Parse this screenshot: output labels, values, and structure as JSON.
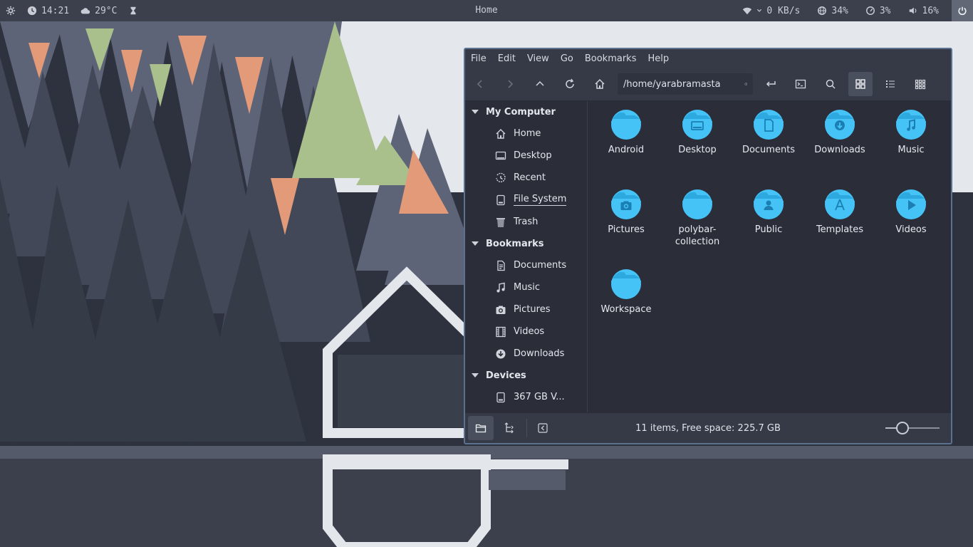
{
  "topbar": {
    "time": "14:21",
    "weather": "29°C",
    "workspace_title": "Home",
    "network_speed": "0 KB/s",
    "cpu": "34%",
    "memory": "3%",
    "volume": "16%",
    "icons": [
      "gear-icon",
      "clock-icon",
      "cloud-icon",
      "hourglass-icon",
      "wifi-icon",
      "globe-icon",
      "gauge-icon",
      "speaker-icon",
      "power-icon"
    ]
  },
  "window": {
    "menu": [
      "File",
      "Edit",
      "View",
      "Go",
      "Bookmarks",
      "Help"
    ],
    "path": "/home/yarabramasta",
    "sidebar": {
      "sections": [
        {
          "title": "My Computer",
          "items": [
            {
              "label": "Home",
              "icon": "home-icon"
            },
            {
              "label": "Desktop",
              "icon": "desktop-icon"
            },
            {
              "label": "Recent",
              "icon": "recent-icon"
            },
            {
              "label": "File System",
              "icon": "drive-icon"
            },
            {
              "label": "Trash",
              "icon": "trash-icon"
            }
          ]
        },
        {
          "title": "Bookmarks",
          "items": [
            {
              "label": "Documents",
              "icon": "documents-icon"
            },
            {
              "label": "Music",
              "icon": "music-icon"
            },
            {
              "label": "Pictures",
              "icon": "camera-icon"
            },
            {
              "label": "Videos",
              "icon": "film-icon"
            },
            {
              "label": "Downloads",
              "icon": "download-icon"
            }
          ]
        },
        {
          "title": "Devices",
          "items": [
            {
              "label": "367 GB V...",
              "icon": "drive-icon"
            }
          ]
        }
      ]
    },
    "files": [
      {
        "name": "Android",
        "glyph": ""
      },
      {
        "name": "Desktop",
        "glyph": "desktop"
      },
      {
        "name": "Documents",
        "glyph": "document"
      },
      {
        "name": "Downloads",
        "glyph": "download"
      },
      {
        "name": "Music",
        "glyph": "music"
      },
      {
        "name": "Pictures",
        "glyph": "camera"
      },
      {
        "name": "polybar-\ncollection",
        "glyph": ""
      },
      {
        "name": "Public",
        "glyph": "person"
      },
      {
        "name": "Templates",
        "glyph": "template"
      },
      {
        "name": "Videos",
        "glyph": "play"
      },
      {
        "name": "Workspace",
        "glyph": ""
      }
    ],
    "status": "11 items, Free space: 225.7 GB",
    "zoom_level": 0.32
  },
  "colors": {
    "folder": "#45c3f7",
    "folder_dark": "#2ea9df",
    "accent_border": "#5b7190"
  }
}
